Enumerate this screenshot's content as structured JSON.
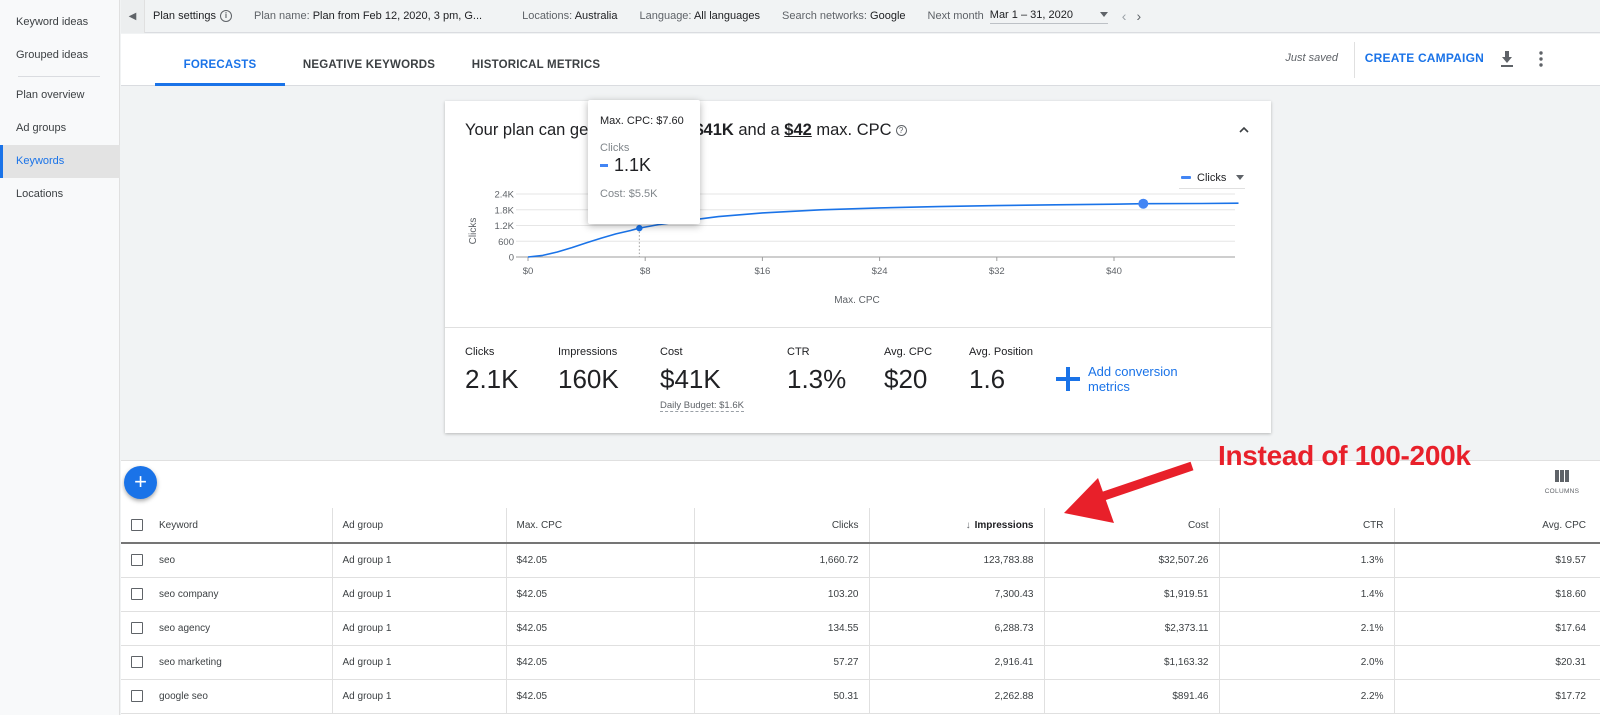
{
  "sidebar": {
    "items": [
      {
        "label": "Keyword ideas",
        "active": false
      },
      {
        "label": "Grouped ideas",
        "active": false
      },
      {
        "label": "Plan overview",
        "active": false
      },
      {
        "label": "Ad groups",
        "active": false
      },
      {
        "label": "Keywords",
        "active": true
      },
      {
        "label": "Locations",
        "active": false
      }
    ]
  },
  "settings_bar": {
    "plan_settings": "Plan settings",
    "plan_name_label": "Plan name:",
    "plan_name_value": "Plan from Feb 12, 2020, 3 pm, G...",
    "locations_label": "Locations:",
    "locations_value": "Australia",
    "language_label": "Language:",
    "language_value": "All languages",
    "networks_label": "Search networks:",
    "networks_value": "Google",
    "period_label": "Next month",
    "period_value": "Mar 1 – 31, 2020"
  },
  "header": {
    "tabs": [
      {
        "label": "FORECASTS",
        "active": true
      },
      {
        "label": "NEGATIVE KEYWORDS",
        "active": false
      },
      {
        "label": "HISTORICAL METRICS",
        "active": false
      }
    ],
    "save_status": "Just saved",
    "create_campaign": "CREATE CAMPAIGN"
  },
  "forecast": {
    "title_prefix": "Your plan can ge",
    "title_mid1": "r ",
    "title_cost": "$41K",
    "title_mid2": " and a ",
    "title_cpc": "$42",
    "title_suffix": " max. CPC",
    "legend_series": "Clicks",
    "tooltip": {
      "header": "Max. CPC: $7.60",
      "series": "Clicks",
      "value": "1.1K",
      "cost": "Cost: $5.5K"
    },
    "metrics": [
      {
        "label": "Clicks",
        "value": "2.1K"
      },
      {
        "label": "Impressions",
        "value": "160K"
      },
      {
        "label": "Cost",
        "value": "$41K",
        "sub": "Daily Budget: $1.6K"
      },
      {
        "label": "CTR",
        "value": "1.3%"
      },
      {
        "label": "Avg. CPC",
        "value": "$20"
      },
      {
        "label": "Avg. Position",
        "value": "1.6"
      }
    ],
    "add_conversion": "Add conversion metrics"
  },
  "chart_data": {
    "type": "line",
    "title": "",
    "xlabel": "Max. CPC",
    "ylabel": "Clicks",
    "xlim": [
      0,
      50
    ],
    "ylim": [
      0,
      2400
    ],
    "x_ticks": [
      0,
      8,
      16,
      24,
      32,
      40
    ],
    "x_tick_labels": [
      "$0",
      "$8",
      "$16",
      "$24",
      "$32",
      "$40"
    ],
    "y_ticks": [
      0,
      600,
      1200,
      1800,
      2400
    ],
    "y_tick_labels": [
      "0",
      "600",
      "1.2K",
      "1.8K",
      "2.4K"
    ],
    "grid": true,
    "legend": "top-right",
    "series": [
      {
        "name": "Clicks",
        "color": "#1a73e8",
        "x": [
          0,
          1,
          2,
          3,
          4,
          5,
          6,
          7,
          7.6,
          9,
          11,
          13,
          16,
          20,
          24,
          28,
          32,
          36,
          40,
          42,
          46,
          48.5
        ],
        "y": [
          0,
          60,
          190,
          360,
          540,
          720,
          880,
          1010,
          1100,
          1240,
          1400,
          1540,
          1680,
          1800,
          1870,
          1920,
          1960,
          1990,
          2010,
          2030,
          2040,
          2050
        ]
      }
    ],
    "highlighted_points": [
      {
        "x": 7.6,
        "y": 1100,
        "label": "hover"
      },
      {
        "x": 42,
        "y": 2030,
        "label": "selected max CPC"
      }
    ]
  },
  "table": {
    "add_label": "+",
    "columns_label": "COLUMNS",
    "headers": [
      "Keyword",
      "Ad group",
      "Max. CPC",
      "Clicks",
      "Impressions",
      "Cost",
      "CTR",
      "Avg. CPC"
    ],
    "sorted_column": "Impressions",
    "rows": [
      [
        "seo",
        "Ad group 1",
        "$42.05",
        "1,660.72",
        "123,783.88",
        "$32,507.26",
        "1.3%",
        "$19.57"
      ],
      [
        "seo company",
        "Ad group 1",
        "$42.05",
        "103.20",
        "7,300.43",
        "$1,919.51",
        "1.4%",
        "$18.60"
      ],
      [
        "seo agency",
        "Ad group 1",
        "$42.05",
        "134.55",
        "6,288.73",
        "$2,373.11",
        "2.1%",
        "$17.64"
      ],
      [
        "seo marketing",
        "Ad group 1",
        "$42.05",
        "57.27",
        "2,916.41",
        "$1,163.32",
        "2.0%",
        "$20.31"
      ],
      [
        "google seo",
        "Ad group 1",
        "$42.05",
        "50.31",
        "2,262.88",
        "$891.46",
        "2.2%",
        "$17.72"
      ]
    ]
  },
  "annotation": {
    "text": "Instead of 100-200k",
    "color": "#e8202a"
  }
}
